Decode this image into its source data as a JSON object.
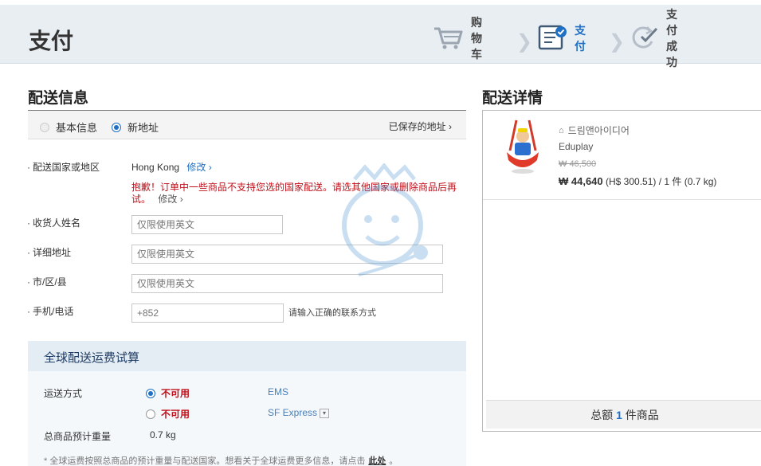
{
  "header": {
    "title": "支付",
    "steps": [
      {
        "label": "购物车",
        "icon": "shopping-cart-icon"
      },
      {
        "label": "支付",
        "icon": "checklist-icon"
      },
      {
        "label": "支付成功",
        "icon": "refresh-check-icon"
      }
    ]
  },
  "shipping_info": {
    "title": "配送信息",
    "tabs": {
      "basic": "基本信息",
      "new": "新地址"
    },
    "saved_address": "已保存的地址",
    "country": {
      "label": "配送国家或地区",
      "value": "Hong Kong",
      "modify": "修改",
      "error": "抱歉！订单中一些商品不支持您选的国家配送。请选其他国家或删除商品后再试。",
      "error_modify": "修改"
    },
    "name": {
      "label": "收货人姓名",
      "placeholder": "仅限使用英文"
    },
    "address": {
      "label": "详细地址",
      "placeholder": "仅限使用英文"
    },
    "city": {
      "label": "市/区/县",
      "placeholder": "仅限使用英文"
    },
    "phone": {
      "label": "手机/电话",
      "placeholder": "+852",
      "hint": "请输入正确的联系方式"
    }
  },
  "shipping_estimate": {
    "title": "全球配送运费试算",
    "method_label": "运送方式",
    "options": [
      {
        "status": "不可用",
        "carrier": "EMS",
        "selected": true
      },
      {
        "status": "不可用",
        "carrier": "SF Express",
        "selected": false
      }
    ],
    "weight_label": "总商品预计重量",
    "weight_value": "0.7 kg",
    "footnote": "* 全球运费按照总商品的预计重量与配送国家。想看关于全球运费更多信息，请点击",
    "footnote_link": "此处",
    "footnote_end": "。"
  },
  "delivery_details": {
    "title": "配送详情",
    "product": {
      "seller": "드림앤아이디어",
      "brand": "Eduplay",
      "original_price": "₩ 46,500",
      "price": "₩ 44,640",
      "hkd": "(H$ 300.51)",
      "qty": "/ 1 件 (0.7 kg)"
    },
    "total_prefix": "总额",
    "total_count": "1",
    "total_suffix": "件商品"
  },
  "colors": {
    "accent": "#1f6fc4",
    "error": "#c0101a",
    "header_bg": "#e9eef3"
  }
}
